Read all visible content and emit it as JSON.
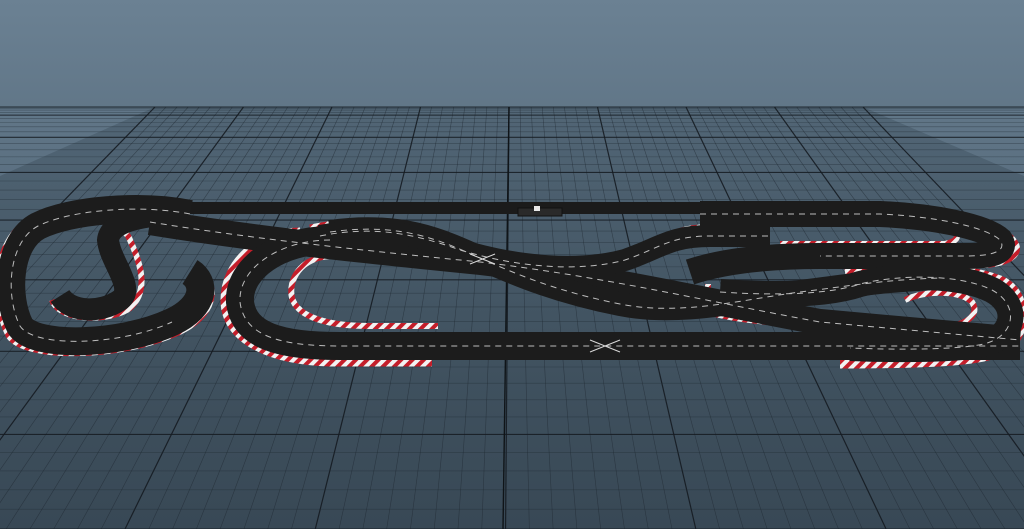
{
  "scene": {
    "background_top_color": "#5e7486",
    "background_bottom_color": "#2e3a45",
    "grid_color": "#1e2730",
    "grid_major_color": "#151b21",
    "floor_color": "#3e4f5d",
    "track_color": "#1c1c1c",
    "track_edge_color": "#0e0e0e",
    "lane_line_color": "#cfcfcf",
    "kerb_red_color": "#c41e2a",
    "kerb_white_color": "#f2f2f2"
  },
  "track": {
    "name": "",
    "lanes": 2,
    "has_crossover": true,
    "has_start_gantry": true
  }
}
